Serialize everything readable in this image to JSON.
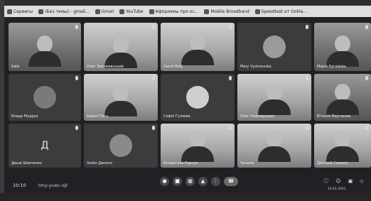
{
  "bookmarks": [
    {
      "label": "Сервисы",
      "icon": "apps-icon"
    },
    {
      "label": "(Без темы) - gmail...",
      "icon": "gmail-icon"
    },
    {
      "label": "Gmail",
      "icon": "gmail-icon"
    },
    {
      "label": "YouTube",
      "icon": "youtube-icon"
    },
    {
      "label": "Афоризмы про ос...",
      "icon": "page-icon"
    },
    {
      "label": "Mobile Broadband",
      "icon": "broadband-icon"
    },
    {
      "label": "Speedtest от Ookla...",
      "icon": "speedtest-icon"
    }
  ],
  "participants": [
    {
      "name": "Kate",
      "video": "camera"
    },
    {
      "name": "Олег Звєзжевський",
      "video": "camera"
    },
    {
      "name": "David Belij",
      "video": "camera"
    },
    {
      "name": "Mary Vyshnevska",
      "video": "avatar"
    },
    {
      "name": "Марія Бугайова",
      "video": "camera"
    },
    {
      "name": "Влада Мудрук",
      "video": "avatar"
    },
    {
      "name": "Кирил Песь",
      "video": "camera"
    },
    {
      "name": "Софія Гуляєва",
      "video": "avatar"
    },
    {
      "name": "Олег Наймирушко",
      "video": "camera"
    },
    {
      "name": "Віталій Мартинюк",
      "video": "camera"
    },
    {
      "name": "Даша Шевченко",
      "video": "letter",
      "letter": "Д"
    },
    {
      "name": "Хоміх Данило",
      "video": "avatar"
    },
    {
      "name": "Владислав Радчук",
      "video": "camera"
    },
    {
      "name": "Чанина",
      "video": "camera"
    },
    {
      "name": "Дмитрій Сорокін",
      "video": "camera"
    }
  ],
  "meeting": {
    "time": "10:10",
    "code": "tmy-yuec-ojt"
  },
  "controls": {
    "mic_icon": "microphone-icon",
    "cam_icon": "camera-icon",
    "captions_icon": "captions-icon",
    "present_icon": "present-icon",
    "more_icon": "more-icon",
    "end_icon": "end-call-icon"
  },
  "tray": {
    "time": "10:10",
    "date": "14.01.2021"
  },
  "colors": {
    "meet_bg": "#202124",
    "tile_bg": "#3c3c3c"
  }
}
